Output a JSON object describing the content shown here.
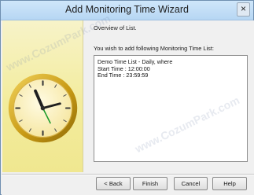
{
  "window": {
    "title": "Add Monitoring Time Wizard",
    "close_glyph": "×"
  },
  "content": {
    "heading": "Overview of List.",
    "intro": "You wish to add following Monitoring Time List:",
    "list_lines": [
      "Demo Time List - Daily, where",
      "Start Time : 12:00:00",
      "End Time : 23:59:59"
    ]
  },
  "buttons": {
    "back": "< Back",
    "finish": "Finish",
    "cancel": "Cancel",
    "help": "Help"
  },
  "watermark": {
    "text": "www.CozumPark.com"
  },
  "icons": {
    "clock": "clock-icon",
    "close": "close-icon"
  },
  "colors": {
    "title_bar": "#b6d6f3",
    "side_panel": "#f3ec9c",
    "clock_face": "#fff6c8",
    "clock_rim": "#c89a15"
  }
}
